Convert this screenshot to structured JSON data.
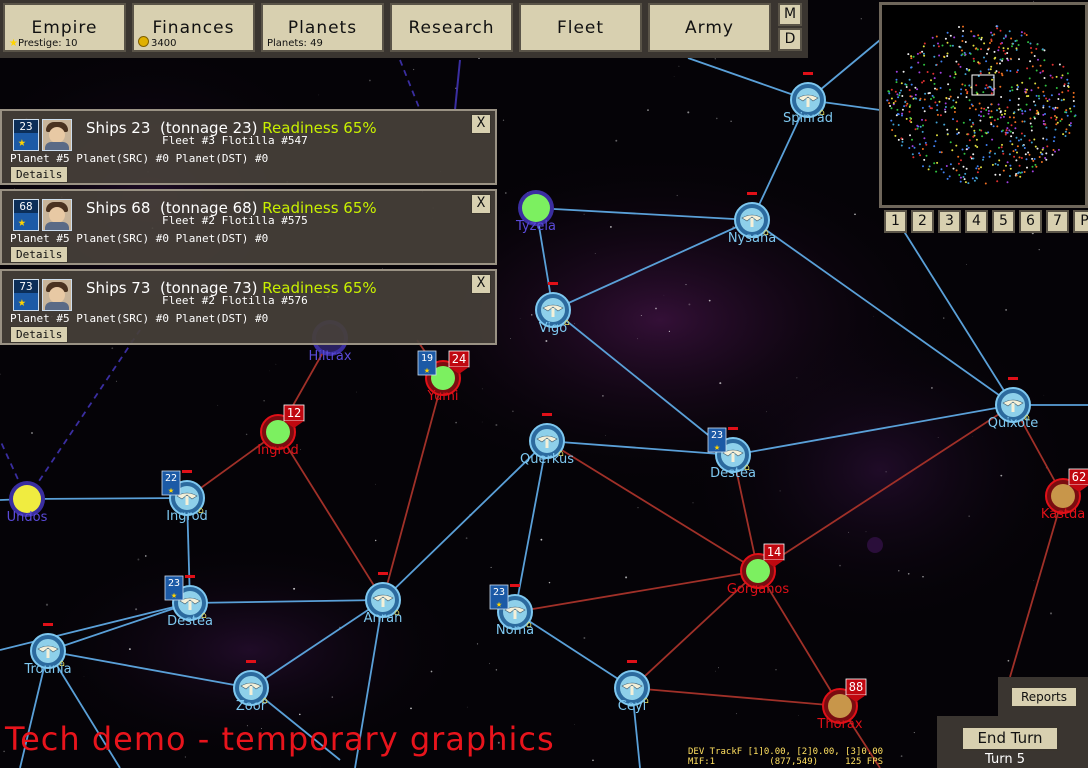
{
  "topbar": {
    "buttons": [
      {
        "label": "Empire",
        "sub": "Prestige: 10",
        "icon": "star-icon"
      },
      {
        "label": "Finances",
        "sub": "3400",
        "icon": "coin-icon"
      },
      {
        "label": "Planets",
        "sub": "Planets: 49",
        "icon": ""
      },
      {
        "label": "Research",
        "sub": "",
        "icon": ""
      },
      {
        "label": "Fleet",
        "sub": "",
        "icon": ""
      },
      {
        "label": "Army",
        "sub": "",
        "icon": ""
      }
    ],
    "m_label": "M",
    "d_label": "D"
  },
  "minimap": {
    "buttons": [
      "1",
      "2",
      "3",
      "4",
      "5",
      "6",
      "7",
      "P"
    ]
  },
  "fleet_panels": [
    {
      "count": "23",
      "title": "Ships 23",
      "tonnage": "(tonnage 23)",
      "readiness": "Readiness 65%",
      "fleet_line": "Fleet #3 Flotilla #547",
      "planet_line": "Planet #5 Planet(SRC) #0 Planet(DST) #0",
      "details": "Details",
      "close": "X"
    },
    {
      "count": "68",
      "title": "Ships 68",
      "tonnage": "(tonnage 68)",
      "readiness": "Readiness 65%",
      "fleet_line": "Fleet #2 Flotilla #575",
      "planet_line": "Planet #5 Planet(SRC) #0 Planet(DST) #0",
      "details": "Details",
      "close": "X"
    },
    {
      "count": "73",
      "title": "Ships 73",
      "tonnage": "(tonnage 73)",
      "readiness": "Readiness 65%",
      "fleet_line": "Fleet #2 Flotilla #576",
      "planet_line": "Planet #5 Planet(SRC) #0 Planet(DST) #0",
      "details": "Details",
      "close": "X"
    }
  ],
  "colors": {
    "player": "#7ec8f0",
    "enemy_red": "#e01018",
    "neutral": "#3a2ea0",
    "lane_blue": "#5aa0d8",
    "lane_red": "#a03028",
    "readiness": "#c8f000"
  },
  "planets": [
    {
      "name": "Spinrad",
      "owner": "player",
      "badge": ""
    },
    {
      "name": "Tyzela",
      "owner": "neutral",
      "badge": ""
    },
    {
      "name": "Nysana",
      "owner": "player",
      "badge": ""
    },
    {
      "name": "Vigo",
      "owner": "player",
      "badge": ""
    },
    {
      "name": "Yumi",
      "owner": "enemy",
      "badge": "24",
      "fleet": "19"
    },
    {
      "name": "Ingrod",
      "owner": "enemy",
      "badge": "12"
    },
    {
      "name": "Quixote",
      "owner": "player",
      "badge": ""
    },
    {
      "name": "Querkus",
      "owner": "player",
      "badge": ""
    },
    {
      "name": "Destea",
      "owner": "player",
      "badge": "",
      "fleet": "23"
    },
    {
      "name": "Kastda",
      "owner": "enemy",
      "badge": "62"
    },
    {
      "name": "Undos",
      "owner": "neutral",
      "badge": ""
    },
    {
      "name": "Ingrod",
      "owner": "player",
      "badge": "",
      "fleet": "22"
    },
    {
      "name": "Gorganos",
      "owner": "enemy",
      "badge": "14"
    },
    {
      "name": "Destea",
      "owner": "player",
      "badge": "",
      "fleet": "23"
    },
    {
      "name": "Anran",
      "owner": "player",
      "badge": ""
    },
    {
      "name": "Noma",
      "owner": "player",
      "badge": "",
      "fleet": "23"
    },
    {
      "name": "Trounia",
      "owner": "player",
      "badge": ""
    },
    {
      "name": "Zoor",
      "owner": "player",
      "badge": ""
    },
    {
      "name": "Ceyl",
      "owner": "player",
      "badge": ""
    },
    {
      "name": "Thorax",
      "owner": "enemy",
      "badge": "88"
    },
    {
      "name": "Hiltrax",
      "owner": "neutral",
      "badge": ""
    }
  ],
  "reports_label": "Reports",
  "end_turn_label": "End Turn",
  "turn_label": "Turn 5",
  "tech_demo": "Tech demo - temporary graphics",
  "dev_line1": "DEV TrackF [1]0.00, [2]0.00, [3]0.00",
  "dev_line2": "MIF:1          (877,549)     125 FPS"
}
